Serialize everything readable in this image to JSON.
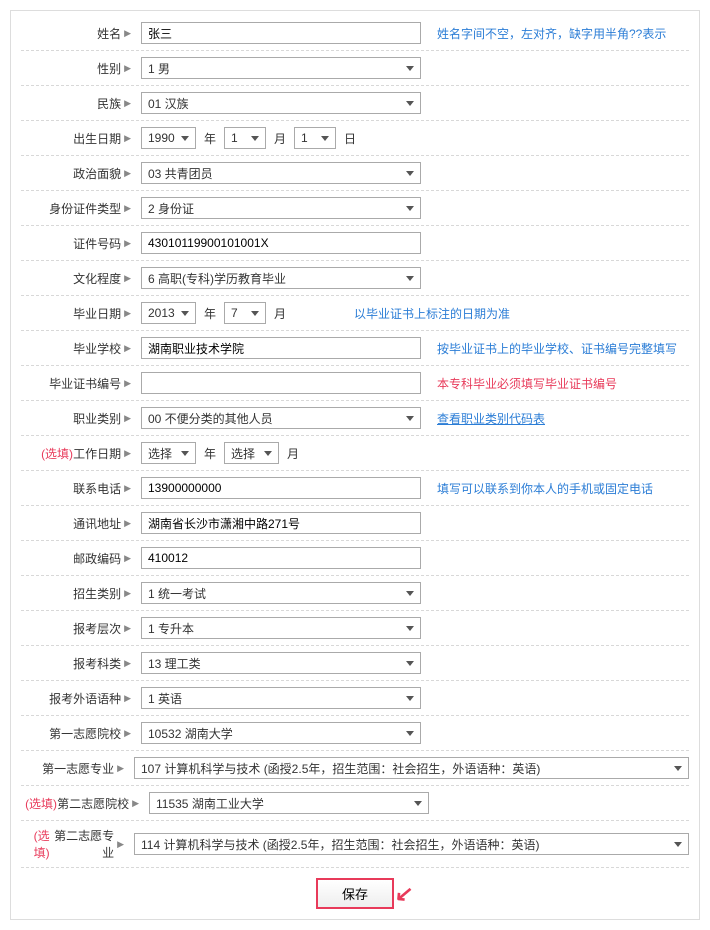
{
  "labels": {
    "name": "姓名",
    "gender": "性别",
    "ethnicity": "民族",
    "birthdate": "出生日期",
    "political": "政治面貌",
    "idtype": "身份证件类型",
    "idnum": "证件号码",
    "education": "文化程度",
    "graddate": "毕业日期",
    "school": "毕业学校",
    "certnum": "毕业证书编号",
    "jobcat": "职业类别",
    "workdate": "工作日期",
    "phone": "联系电话",
    "address": "通讯地址",
    "postal": "邮政编码",
    "admittype": "招生类别",
    "level": "报考层次",
    "subject": "报考科类",
    "language": "报考外语语种",
    "school1": "第一志愿院校",
    "major1": "第一志愿专业",
    "school2": "第二志愿院校",
    "major2": "第二志愿专业",
    "optional": "(选填)",
    "year": "年",
    "month": "月",
    "day": "日",
    "save": "保存"
  },
  "values": {
    "name": "张三",
    "gender": "1 男",
    "ethnicity": "01 汉族",
    "birth_year": "1990",
    "birth_month": "1",
    "birth_day": "1",
    "political": "03 共青团员",
    "idtype": "2 身份证",
    "idnum": "43010119900101001X",
    "education": "6 高职(专科)学历教育毕业",
    "grad_year": "2013",
    "grad_month": "7",
    "school": "湖南职业技术学院",
    "certnum": "",
    "jobcat": "00 不便分类的其他人员",
    "work_year": "选择",
    "work_month": "选择",
    "phone": "13900000000",
    "address": "湖南省长沙市潇湘中路271号",
    "postal": "410012",
    "admittype": "1 统一考试",
    "level": "1 专升本",
    "subject": "13 理工类",
    "language": "1 英语",
    "school1": "10532 湖南大学",
    "major1": "107 计算机科学与技术 (函授2.5年，招生范围：社会招生，外语语种：英语)",
    "school2": "11535 湖南工业大学",
    "major2": "114 计算机科学与技术 (函授2.5年，招生范围：社会招生，外语语种：英语)"
  },
  "hints": {
    "name": "姓名字间不空，左对齐，缺字用半角??表示",
    "graddate": "以毕业证书上标注的日期为准",
    "school": "按毕业证书上的毕业学校、证书编号完整填写",
    "certnum": "本专科毕业必须填写毕业证书编号",
    "jobcat": "查看职业类别代码表",
    "phone": "填写可以联系到你本人的手机或固定电话"
  }
}
